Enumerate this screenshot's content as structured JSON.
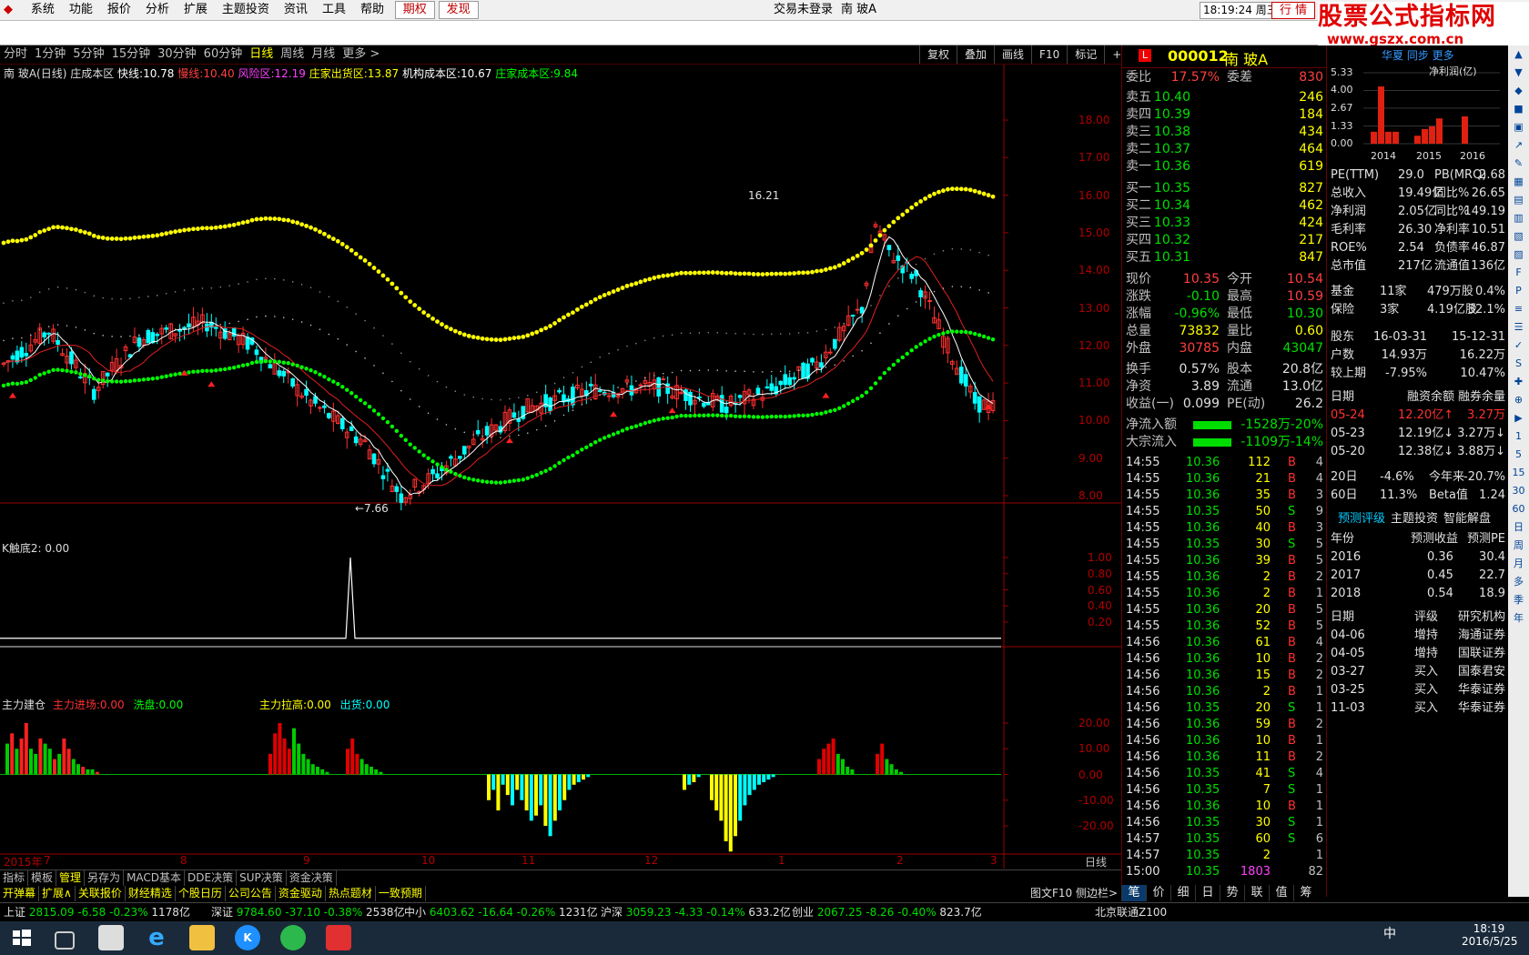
{
  "menubar": {
    "items": [
      "系统",
      "功能",
      "报价",
      "分析",
      "扩展",
      "主题投资",
      "资讯",
      "工具",
      "帮助"
    ],
    "highlight": [
      "期权",
      "发现"
    ],
    "login": "交易未登录",
    "stock_title": "南  玻A",
    "time": "18:19:24 周三",
    "trade": "行  情"
  },
  "logo": {
    "title": "股票公式指标网",
    "url": "www.gszx.com.cn"
  },
  "periods": [
    "分时",
    "1分钟",
    "5分钟",
    "15分钟",
    "30分钟",
    "60分钟",
    "日线",
    "周线",
    "月线",
    "更多 >"
  ],
  "active_period": "日线",
  "right_tools": [
    "复权",
    "叠加",
    "画线",
    "F10",
    "标记",
    "+自选"
  ],
  "main_chart": {
    "header": {
      "name": "南  玻A(日线) 庄成本区",
      "fast_label": "快线:",
      "fast": "10.78",
      "slow_label": "慢线:",
      "slow": "10.40",
      "risk_label": "风险区:",
      "risk": "12.19",
      "dealer_out_label": "庄家出货区:",
      "dealer_out": "13.87",
      "inst_label": "机构成本区:",
      "inst": "10.67",
      "dealer_cost_label": "庄家成本区:",
      "dealer_cost": "9.84"
    },
    "y_ticks": [
      "18.00",
      "17.00",
      "16.00",
      "15.00",
      "14.00",
      "13.00",
      "12.00",
      "11.00",
      "10.00",
      "9.00",
      "8.00"
    ],
    "high_label": "16.21",
    "low_label": "←7.66"
  },
  "sub1": {
    "header_name": "K触底2",
    "header_value": ": 0.00",
    "y_ticks": [
      "1.00",
      "0.80",
      "0.60",
      "0.40",
      "0.20"
    ]
  },
  "sub2": {
    "name": "主力建仓",
    "in_label": "主力进场:",
    "in": "0.00",
    "wash_label": "洗盘:",
    "wash": "0.00",
    "pull_label": "主力拉高:",
    "pull": "0.00",
    "out_label": "出货:",
    "out": "0.00",
    "y_ticks": [
      "20.00",
      "10.00",
      "0.00",
      "-10.00",
      "-20.00"
    ]
  },
  "x_axis": [
    "2015年",
    "7",
    "8",
    "9",
    "10",
    "11",
    "12",
    "1",
    "2",
    "3"
  ],
  "x_axis_right": "日线",
  "scroll_ctrl": [
    "+",
    "-",
    "0"
  ],
  "tabs1": [
    "指标",
    "模板",
    "管理",
    "另存为",
    "MACD基本",
    "DDE决策",
    "SUP决策",
    "资金决策"
  ],
  "tabs1_active": "管理",
  "tabs2": [
    "开弹幕",
    "扩展∧",
    "关联报价",
    "财经精选",
    "个股日历",
    "公司公告",
    "资金驱动",
    "热点题材",
    "一致预期"
  ],
  "tabs2_right": [
    "图文F10",
    "侧边栏>"
  ],
  "quote": {
    "code": "000012",
    "name": "南  玻A",
    "webi": {
      "label": "委比",
      "v": "17.57%",
      "label2": "委差",
      "v2": "830"
    },
    "sell": [
      {
        "l": "卖五",
        "p": "10.40",
        "q": "246"
      },
      {
        "l": "卖四",
        "p": "10.39",
        "q": "184"
      },
      {
        "l": "卖三",
        "p": "10.38",
        "q": "434"
      },
      {
        "l": "卖二",
        "p": "10.37",
        "q": "464"
      },
      {
        "l": "卖一",
        "p": "10.36",
        "q": "619"
      }
    ],
    "buy": [
      {
        "l": "买一",
        "p": "10.35",
        "q": "827"
      },
      {
        "l": "买二",
        "p": "10.34",
        "q": "462"
      },
      {
        "l": "买三",
        "p": "10.33",
        "q": "424"
      },
      {
        "l": "买四",
        "p": "10.32",
        "q": "217"
      },
      {
        "l": "买五",
        "p": "10.31",
        "q": "847"
      }
    ],
    "stats": [
      {
        "l": "现价",
        "v": "10.35",
        "l2": "今开",
        "v2": "10.54"
      },
      {
        "l": "涨跌",
        "v": "-0.10",
        "l2": "最高",
        "v2": "10.59"
      },
      {
        "l": "涨幅",
        "v": "-0.96%",
        "l2": "最低",
        "v2": "10.30"
      },
      {
        "l": "总量",
        "v": "73832",
        "l2": "量比",
        "v2": "0.60"
      },
      {
        "l": "外盘",
        "v": "30785",
        "l2": "内盘",
        "v2": "43047"
      }
    ],
    "stats2": [
      {
        "l": "换手",
        "v": "0.57%",
        "l2": "股本",
        "v2": "20.8亿"
      },
      {
        "l": "净资",
        "v": "3.89",
        "l2": "流通",
        "v2": "13.0亿"
      },
      {
        "l": "收益(一)",
        "v": "0.099",
        "l2": "PE(动)",
        "v2": "26.2"
      }
    ],
    "flows": [
      {
        "l": "净流入额",
        "v": "-1528万",
        "p": "-20%"
      },
      {
        "l": "大宗流入",
        "v": "-1109万",
        "p": "-14%"
      }
    ],
    "ticks": [
      [
        "14:55",
        "10.36",
        "112",
        "B",
        "4"
      ],
      [
        "14:55",
        "10.36",
        "21",
        "B",
        "4"
      ],
      [
        "14:55",
        "10.36",
        "35",
        "B",
        "3"
      ],
      [
        "14:55",
        "10.35",
        "50",
        "S",
        "9"
      ],
      [
        "14:55",
        "10.36",
        "40",
        "B",
        "3"
      ],
      [
        "14:55",
        "10.35",
        "30",
        "S",
        "5"
      ],
      [
        "14:55",
        "10.36",
        "39",
        "B",
        "5"
      ],
      [
        "14:55",
        "10.36",
        "2",
        "B",
        "2"
      ],
      [
        "14:55",
        "10.36",
        "2",
        "B",
        "1"
      ],
      [
        "14:55",
        "10.36",
        "20",
        "B",
        "5"
      ],
      [
        "14:55",
        "10.36",
        "52",
        "B",
        "5"
      ],
      [
        "14:56",
        "10.36",
        "61",
        "B",
        "4"
      ],
      [
        "14:56",
        "10.36",
        "10",
        "B",
        "2"
      ],
      [
        "14:56",
        "10.36",
        "15",
        "B",
        "2"
      ],
      [
        "14:56",
        "10.36",
        "2",
        "B",
        "1"
      ],
      [
        "14:56",
        "10.35",
        "20",
        "S",
        "1"
      ],
      [
        "14:56",
        "10.36",
        "59",
        "B",
        "2"
      ],
      [
        "14:56",
        "10.36",
        "10",
        "B",
        "1"
      ],
      [
        "14:56",
        "10.36",
        "11",
        "B",
        "2"
      ],
      [
        "14:56",
        "10.35",
        "41",
        "S",
        "4"
      ],
      [
        "14:56",
        "10.35",
        "7",
        "S",
        "1"
      ],
      [
        "14:56",
        "10.36",
        "10",
        "B",
        "1"
      ],
      [
        "14:56",
        "10.35",
        "30",
        "S",
        "1"
      ],
      [
        "14:57",
        "10.35",
        "60",
        "S",
        "6"
      ],
      [
        "14:57",
        "10.35",
        "2",
        "",
        "1"
      ],
      [
        "15:00",
        "10.35",
        "1803",
        "",
        "82"
      ]
    ]
  },
  "right_tabs": [
    "笔",
    "价",
    "细",
    "日",
    "势",
    "联",
    "值",
    "筹"
  ],
  "f10": {
    "tabs": [
      "华夏",
      "同步",
      "更多"
    ],
    "chart_label": "净利润(亿)",
    "chart_y": [
      "5.33",
      "4.00",
      "2.67",
      "1.33",
      "0.00"
    ],
    "chart_x": [
      "2014",
      "2015",
      "2016"
    ],
    "rows1": [
      [
        "PE(TTM)",
        "29.0",
        "PB(MRQ)",
        "2.68"
      ],
      [
        "总收入",
        "19.49亿",
        "同比%",
        "26.65"
      ],
      [
        "净利润",
        "2.05亿",
        "同比%",
        "149.19"
      ],
      [
        "毛利率",
        "26.30",
        "净利率",
        "10.51"
      ],
      [
        "ROE%",
        "2.54",
        "负债率",
        "46.87"
      ],
      [
        "总市值",
        "217亿",
        "流通值",
        "136亿"
      ]
    ],
    "rows2": [
      [
        "基金",
        "11家",
        "479万股",
        "0.4%"
      ],
      [
        "保险",
        "3家",
        "4.19亿股",
        "32.1%"
      ]
    ],
    "holders": [
      [
        "股东",
        "16-03-31",
        "15-12-31"
      ],
      [
        "户数",
        "14.93万",
        "16.22万"
      ],
      [
        "较上期",
        "-7.95%",
        "10.47%"
      ]
    ],
    "margin_hdr": [
      "日期",
      "融资余额",
      "融券余量"
    ],
    "margin": [
      [
        "05-24",
        "12.20亿↑",
        "3.27万"
      ],
      [
        "05-23",
        "12.19亿↓",
        "3.27万↓"
      ],
      [
        "05-20",
        "12.38亿↓",
        "3.88万↓"
      ]
    ],
    "perf": [
      [
        "20日",
        "-4.6%",
        "今年来",
        "-20.7%"
      ],
      [
        "60日",
        "11.3%",
        "Beta值",
        "1.24"
      ]
    ],
    "fc_tabs": [
      "预测评级",
      "主题投资",
      "智能解盘"
    ],
    "fc_hdr": [
      "年份",
      "预测收益",
      "预测PE"
    ],
    "fc": [
      [
        "2016",
        "0.36",
        "30.4"
      ],
      [
        "2017",
        "0.45",
        "22.7"
      ],
      [
        "2018",
        "0.54",
        "18.9"
      ]
    ],
    "rating_hdr": [
      "日期",
      "评级",
      "研究机构"
    ],
    "ratings": [
      [
        "04-06",
        "增持",
        "海通证券"
      ],
      [
        "04-05",
        "增持",
        "国联证券"
      ],
      [
        "03-27",
        "买入",
        "国泰君安"
      ],
      [
        "03-25",
        "买入",
        "华泰证券"
      ],
      [
        "11-03",
        "买入",
        "华泰证券"
      ]
    ]
  },
  "status_bar": {
    "sh": [
      "上证",
      "2815.09",
      "-6.58",
      "-0.23%",
      "1178亿"
    ],
    "sz": [
      "深证",
      "9784.60",
      "-37.10",
      "-0.38%",
      "2538亿"
    ],
    "zx": [
      "中小",
      "6403.62",
      "-16.64",
      "-0.26%",
      "1231亿"
    ],
    "hs": [
      "沪深",
      "3059.23",
      "-4.33",
      "-0.14%",
      "633.2亿"
    ],
    "cy": [
      "创业",
      "2067.25",
      "-8.26",
      "-0.40%",
      "823.7亿"
    ],
    "server": "北京联通Z100"
  },
  "taskbar": {
    "time": "18:19",
    "date": "2016/5/25",
    "ime": "中"
  }
}
